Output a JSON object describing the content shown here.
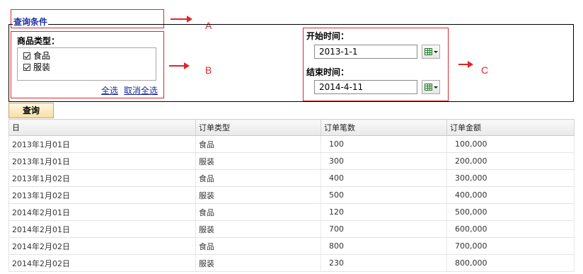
{
  "annotations": {
    "a": "A",
    "b": "B",
    "c": "C"
  },
  "query_panel": {
    "legend": "查询条件",
    "category": {
      "label": "商品类型：",
      "options": [
        {
          "label": "食品",
          "checked": true
        },
        {
          "label": "服装",
          "checked": true
        }
      ],
      "select_all": "全选",
      "deselect_all": "取消全选"
    },
    "start_time": {
      "label": "开始时间：",
      "value": "2013-1-1"
    },
    "end_time": {
      "label": "结束时间：",
      "value": "2014-4-11"
    }
  },
  "query_button": "查询",
  "table": {
    "columns": [
      "日",
      "订单类型",
      "订单笔数",
      "订单金额"
    ],
    "rows": [
      [
        "2013年1月01日",
        "食品",
        "100",
        "100,000"
      ],
      [
        "2013年1月01日",
        "服装",
        "300",
        "200,000"
      ],
      [
        "2013年1月02日",
        "食品",
        "400",
        "300,000"
      ],
      [
        "2013年1月02日",
        "服装",
        "500",
        "400,000"
      ],
      [
        "2014年2月01日",
        "食品",
        "120",
        "500,000"
      ],
      [
        "2014年2月01日",
        "服装",
        "700",
        "600,000"
      ],
      [
        "2014年2月02日",
        "食品",
        "800",
        "700,000"
      ],
      [
        "2014年2月02日",
        "服装",
        "230",
        "800,000"
      ]
    ]
  },
  "colors": {
    "annotation": "#e0262b",
    "legend": "#1b2fa8",
    "link": "#1a2b9a"
  }
}
